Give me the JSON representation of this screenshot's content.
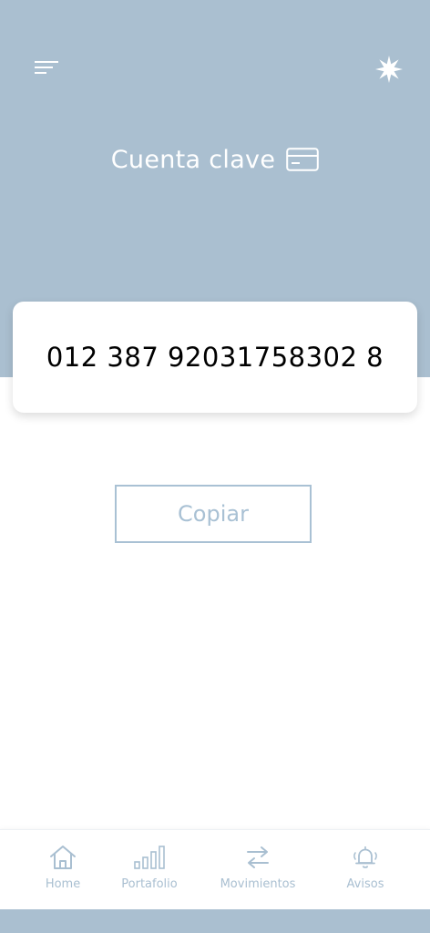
{
  "header": {
    "title": "Cuenta clave",
    "menu_icon": "menu-icon",
    "star_icon": "star-icon",
    "card_icon": "card-icon",
    "background_color": "#aabfd0"
  },
  "account": {
    "number": "012 387 92031758302 8"
  },
  "actions": {
    "copy_label": "Copiar"
  },
  "bottom_nav": {
    "items": [
      {
        "label": "Home",
        "icon": "home-icon"
      },
      {
        "label": "Portafolio",
        "icon": "bar-chart-icon"
      },
      {
        "label": "Movimientos",
        "icon": "transfer-arrows-icon"
      },
      {
        "label": "Avisos",
        "icon": "bell-icon"
      }
    ]
  },
  "colors": {
    "accent": "#a9c1d4",
    "text_dark": "#000000",
    "white": "#ffffff"
  }
}
